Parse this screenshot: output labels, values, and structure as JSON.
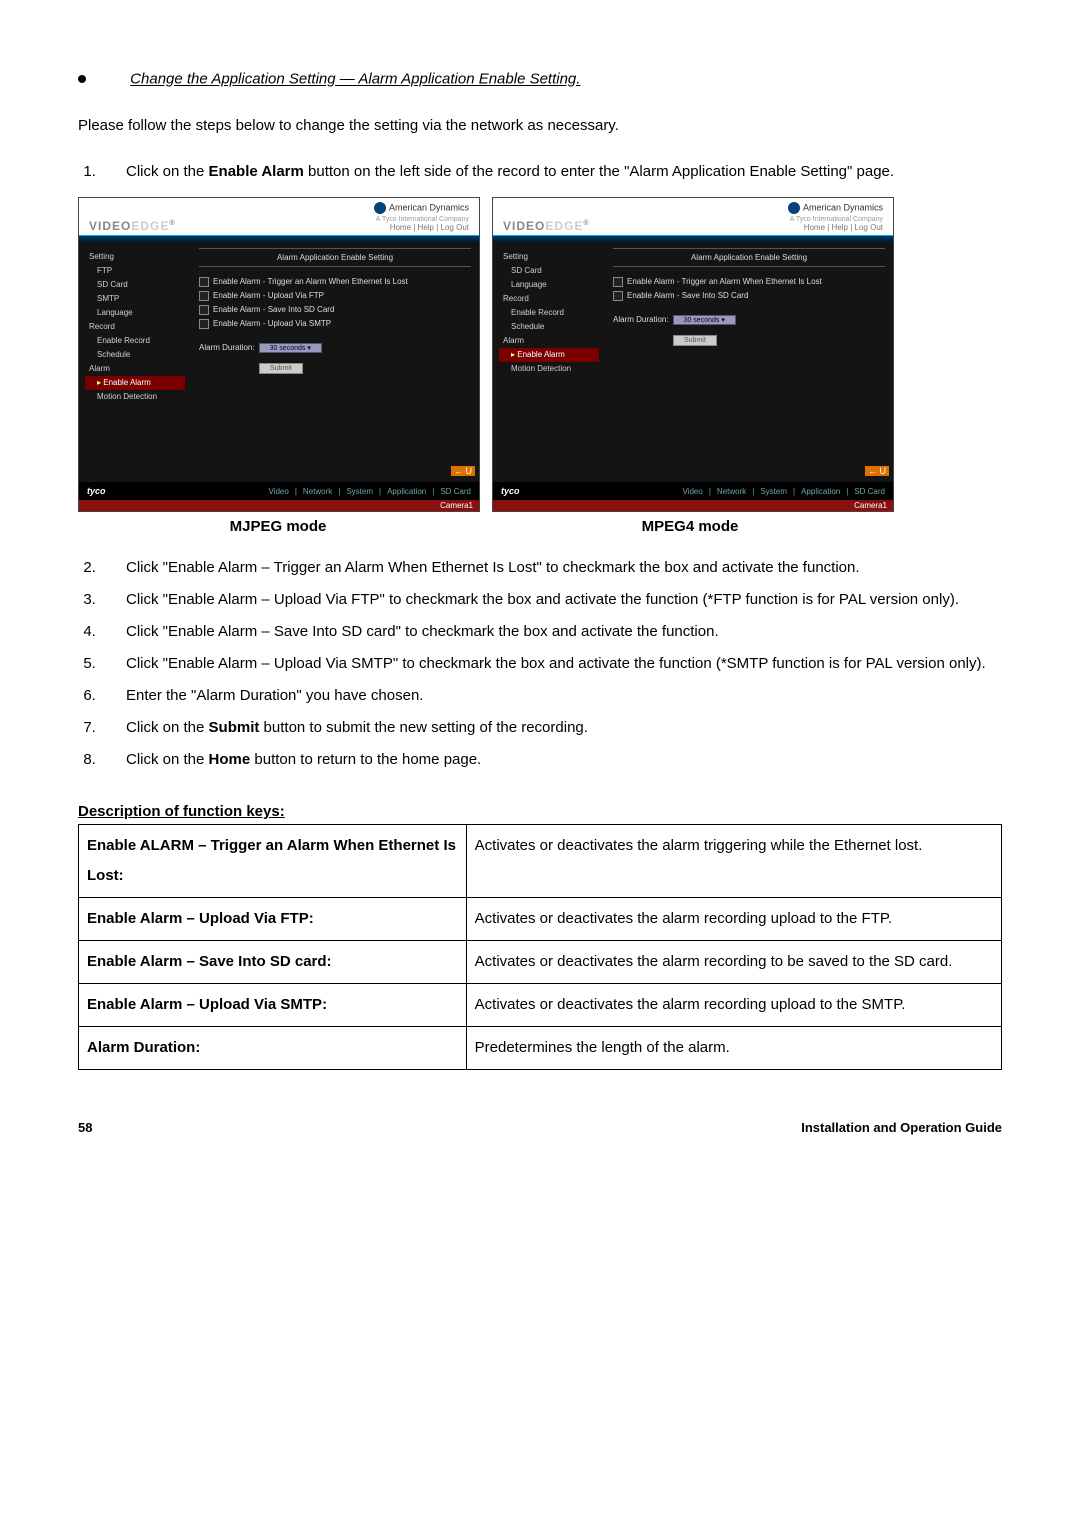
{
  "heading": "Change the Application Setting — Alarm Application Enable Setting.",
  "intro": "Please follow the steps below to change the setting via the network as necessary.",
  "steps_first": [
    {
      "num": "1.",
      "pre": "Click on the ",
      "bold": "Enable Alarm",
      "post": " button on the left side of the record to enter the \"Alarm Application Enable Setting\" page."
    }
  ],
  "panels": {
    "common": {
      "brand_a": "VIDEO",
      "brand_b": "EDGE",
      "brand_sup": "®",
      "ad_name": "American Dynamics",
      "ad_sub": "A Tyco International Company",
      "ad_links": "Home   |   Help   |   Log Out",
      "panel_title": "Alarm Application Enable Setting",
      "duration_label": "Alarm Duration:",
      "duration_value": "30 seconds",
      "submit": "Submit",
      "orange": "← U",
      "nav": [
        "Video",
        "|",
        "Network",
        "|",
        "System",
        "|",
        "Application",
        "|",
        "SD Card"
      ],
      "tyco": "tyco",
      "camera": "Camera1"
    },
    "left": {
      "sidebar": [
        "Setting",
        "FTP",
        "SD Card",
        "SMTP",
        "Language",
        "Record",
        "Enable Record",
        "Schedule",
        "Alarm",
        "Enable Alarm",
        "Motion Detection"
      ],
      "sidebar_sub_idx": [
        1,
        2,
        3,
        4,
        6,
        7,
        9,
        10
      ],
      "sidebar_hl_idx": 9,
      "checks": [
        "Enable Alarm - Trigger an Alarm When Ethernet Is Lost",
        "Enable Alarm - Upload Via FTP",
        "Enable Alarm - Save Into SD Card",
        "Enable Alarm - Upload Via SMTP"
      ],
      "caption": "MJPEG mode"
    },
    "right": {
      "sidebar": [
        "Setting",
        "SD Card",
        "Language",
        "Record",
        "Enable Record",
        "Schedule",
        "Alarm",
        "Enable Alarm",
        "Motion Detection"
      ],
      "sidebar_sub_idx": [
        1,
        2,
        4,
        5,
        7,
        8
      ],
      "sidebar_hl_idx": 7,
      "checks": [
        "Enable Alarm - Trigger an Alarm When Ethernet Is Lost",
        "Enable Alarm - Save Into SD Card"
      ],
      "caption": "MPEG4 mode"
    }
  },
  "steps_rest": [
    {
      "num": "2.",
      "text": "Click \"Enable Alarm – Trigger an Alarm When Ethernet Is Lost\" to checkmark the box and activate the function."
    },
    {
      "num": "3.",
      "text": "Click \"Enable Alarm – Upload Via FTP\" to checkmark the box and activate the function (*FTP function is for PAL version only)."
    },
    {
      "num": "4.",
      "text": "Click \"Enable Alarm – Save Into SD card\" to checkmark the box and activate the function."
    },
    {
      "num": "5.",
      "text": "Click \"Enable Alarm – Upload Via SMTP\" to checkmark the box and activate the function (*SMTP function is for PAL version only)."
    },
    {
      "num": "6.",
      "text": "Enter the \"Alarm Duration\" you have chosen."
    },
    {
      "num": "7.",
      "pre": "Click on the ",
      "bold": "Submit",
      "post": " button to submit the new setting of the recording."
    },
    {
      "num": "8.",
      "pre": "Click on the ",
      "bold": "Home",
      "post": " button to return to the home page."
    }
  ],
  "fk_heading": "Description of function keys:",
  "fk_rows": [
    {
      "k": "Enable ALARM – Trigger an Alarm When Ethernet Is Lost:",
      "v": "Activates or deactivates the alarm triggering while the Ethernet lost."
    },
    {
      "k": "Enable Alarm – Upload Via FTP:",
      "v": "Activates or deactivates the alarm recording upload to the FTP."
    },
    {
      "k": "Enable Alarm – Save Into SD card:",
      "v": "Activates or deactivates the alarm recording to be saved to the SD card."
    },
    {
      "k": "Enable Alarm – Upload Via SMTP:",
      "v": "Activates or deactivates the alarm recording upload to the SMTP."
    },
    {
      "k": "Alarm Duration:",
      "v": "Predetermines the length of the alarm."
    }
  ],
  "page_num": "58",
  "footer": "Installation and Operation Guide"
}
